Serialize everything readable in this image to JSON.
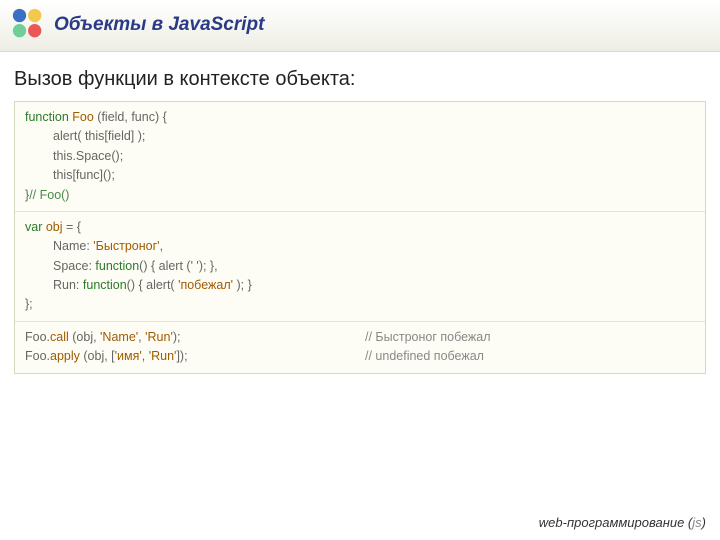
{
  "header": {
    "title": "Объекты в JavaScript"
  },
  "subtitle": "Вызов функции в контексте объекта:",
  "code": {
    "block1": {
      "l1_kw": "function",
      "l1_id": " Foo ",
      "l1_rest": "(field, func) {",
      "l2": "alert( this[field] );",
      "l3": "this.Space();",
      "l4": "this[func]();",
      "l5_a": "}",
      "l5_b": "// Foo()"
    },
    "block2": {
      "l1_kw": "var",
      "l1_id": " obj ",
      "l1_rest": "= {",
      "l2_a": "Name: ",
      "l2_b": "'Быстроног'",
      "l2_c": ",",
      "l3_a": "Space: ",
      "l3_b": "function",
      "l3_c": "() { alert (' '); },",
      "l4_a": "Run: ",
      "l4_b": "function",
      "l4_c": "() { alert( ",
      "l4_d": "'побежал'",
      "l4_e": " ); }",
      "l5": "};"
    },
    "block3": {
      "l1_a": "Foo.",
      "l1_b": "call ",
      "l1_c": "(obj, ",
      "l1_d": "'Name'",
      "l1_e": ", ",
      "l1_f": "'Run'",
      "l1_g": ");",
      "l1_cmt": "// Быстроног побежал",
      "l2_a": "Foo.",
      "l2_b": "apply ",
      "l2_c": "(obj, [",
      "l2_d": "'имя'",
      "l2_e": ", ",
      "l2_f": "'Run'",
      "l2_g": "]);",
      "l2_cmt": "// undefined побежал"
    }
  },
  "footer": {
    "text": "web-программирование ",
    "paren_open": "(",
    "js": "js",
    "paren_close": ")"
  }
}
